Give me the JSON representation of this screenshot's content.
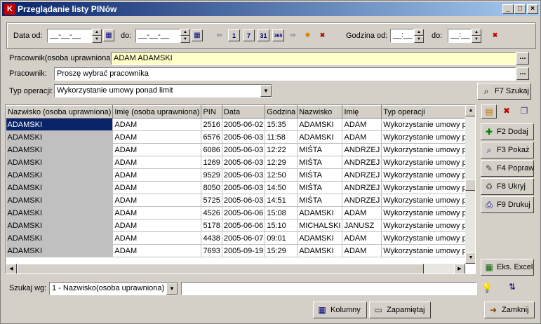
{
  "window": {
    "title": "Przeglądanie listy PINów",
    "app_icon": "K",
    "controls": {
      "minimize": "_",
      "maximize": "□",
      "close": "×"
    }
  },
  "filters": {
    "date_from_label": "Data od:",
    "date_from_value": "__-__-__",
    "date_to_label": "do:",
    "date_to_value": "__-__-__",
    "time_from_label": "Godzina od:",
    "time_from_value": "__:__",
    "time_to_label": "do:",
    "time_to_value": "__:__",
    "toolbar_icons": [
      {
        "name": "arrow-left-icon",
        "glyph": "⇦"
      },
      {
        "name": "calendar-day-icon",
        "glyph": "1"
      },
      {
        "name": "calendar-week-icon",
        "glyph": "7"
      },
      {
        "name": "calendar-month-icon",
        "glyph": "31"
      },
      {
        "name": "calendar-year-icon",
        "glyph": "365"
      },
      {
        "name": "arrow-right-icon",
        "glyph": "⇨"
      },
      {
        "name": "today-icon",
        "glyph": "✹"
      },
      {
        "name": "clear-dates-icon",
        "glyph": "✖"
      }
    ],
    "clear_time_icon": "✖"
  },
  "form": {
    "authorized_employee_label": "Pracownik(osoba uprawniona):",
    "authorized_employee_value": "ADAM ADAMSKI",
    "employee_label": "Pracownik:",
    "employee_value": "Proszę wybrać pracownika",
    "operation_type_label": "Typ operacji:",
    "operation_type_value": "Wykorzystanie umowy ponad limit",
    "browse_label": "...",
    "search_button": "F7 Szukaj"
  },
  "table": {
    "columns": [
      "Nazwisko (osoba uprawniona)",
      "Imię (osoba uprawniona)",
      "PIN",
      "Data",
      "Godzina",
      "Nazwisko",
      "Imię",
      "Typ operacji"
    ],
    "rows": [
      [
        "ADAMSKI",
        "ADAM",
        "2516",
        "2005-06-02",
        "15:35",
        "ADAMSKI",
        "ADAM",
        "Wykorzystanie umowy ponad limit"
      ],
      [
        "ADAMSKI",
        "ADAM",
        "6576",
        "2005-06-03",
        "11:58",
        "ADAMSKI",
        "ADAM",
        "Wykorzystanie umowy ponad limit"
      ],
      [
        "ADAMSKI",
        "ADAM",
        "6086",
        "2005-06-03",
        "12:22",
        "MIŚTA",
        "ANDRZEJ",
        "Wykorzystanie umowy ponad limit"
      ],
      [
        "ADAMSKI",
        "ADAM",
        "1269",
        "2005-06-03",
        "12:29",
        "MIŚTA",
        "ANDRZEJ",
        "Wykorzystanie umowy ponad limit"
      ],
      [
        "ADAMSKI",
        "ADAM",
        "9529",
        "2005-06-03",
        "12:50",
        "MIŚTA",
        "ANDRZEJ",
        "Wykorzystanie umowy ponad limit"
      ],
      [
        "ADAMSKI",
        "ADAM",
        "8050",
        "2005-06-03",
        "14:50",
        "MIŚTA",
        "ANDRZEJ",
        "Wykorzystanie umowy ponad limit"
      ],
      [
        "ADAMSKI",
        "ADAM",
        "5725",
        "2005-06-03",
        "14:51",
        "MIŚTA",
        "ANDRZEJ",
        "Wykorzystanie umowy ponad limit"
      ],
      [
        "ADAMSKI",
        "ADAM",
        "4526",
        "2005-06-06",
        "15:08",
        "ADAMSKI",
        "ADAM",
        "Wykorzystanie umowy ponad limit"
      ],
      [
        "ADAMSKI",
        "ADAM",
        "5178",
        "2005-06-06",
        "15:10",
        "MICHALSKI",
        "JANUSZ",
        "Wykorzystanie umowy ponad limit"
      ],
      [
        "ADAMSKI",
        "ADAM",
        "4438",
        "2005-06-07",
        "09:01",
        "ADAMSKI",
        "ADAM",
        "Wykorzystanie umowy ponad limit"
      ],
      [
        "ADAMSKI",
        "ADAM",
        "7693",
        "2005-09-19",
        "15:29",
        "ADAMSKI",
        "ADAM",
        "Wykorzystanie umowy ponad limit"
      ]
    ]
  },
  "side": {
    "mini_icons": [
      {
        "name": "filter-icon",
        "glyph": "▤"
      },
      {
        "name": "delete-filter-icon",
        "glyph": "✖"
      },
      {
        "name": "copy-icon",
        "glyph": "❐"
      }
    ],
    "buttons": [
      {
        "name": "add-button",
        "label": "F2 Dodaj",
        "icon": "add-icon",
        "glyph": "✚"
      },
      {
        "name": "show-button",
        "label": "F3 Pokaż",
        "icon": "magnifier-icon",
        "glyph": "⌕"
      },
      {
        "name": "edit-button",
        "label": "F4 Popraw",
        "icon": "pencil-icon",
        "glyph": "✎"
      },
      {
        "name": "hide-button",
        "label": "F8 Ukryj",
        "icon": "trash-icon",
        "glyph": "♻"
      },
      {
        "name": "print-button",
        "label": "F9 Drukuj",
        "icon": "printer-icon",
        "glyph": "⎙"
      }
    ],
    "excel_button": "Eks. Excel"
  },
  "search": {
    "label": "Szukaj wg:",
    "field_value": "1 - Nazwisko(osoba uprawniona)",
    "query": ""
  },
  "footer": {
    "columns_button": "Kolumny",
    "remember_button": "Zapamiętaj",
    "close_button": "Zamknij"
  }
}
